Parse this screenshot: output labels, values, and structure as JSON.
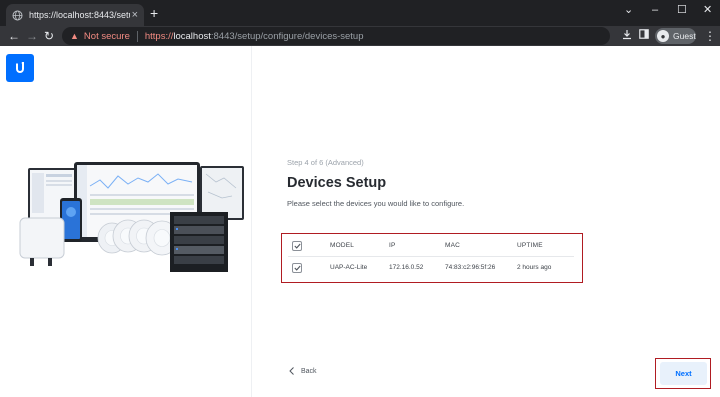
{
  "browser": {
    "tab_title": "https://localhost:8443/setup/configure/devices-setup",
    "tab_close": "×",
    "new_tab": "+",
    "window_controls": {
      "minimize": "–",
      "maximize": "☐",
      "close": "✕",
      "dropdown": "⌄"
    },
    "nav": {
      "back": "←",
      "forward": "→",
      "reload": "↻"
    },
    "address": {
      "warning_icon": "▲",
      "security_label": "Not secure",
      "url_scheme": "https://",
      "url_host": "localhost",
      "url_path": ":8443/setup/configure/devices-setup"
    },
    "profile_label": "Guest",
    "menu": "⋮"
  },
  "setup": {
    "step_label": "Step 4 of 6 (Advanced)",
    "title": "Devices Setup",
    "subtitle": "Please select the devices you would like to configure.",
    "table": {
      "columns": [
        "MODEL",
        "IP",
        "MAC",
        "UPTIME"
      ],
      "header_checked": true,
      "rows": [
        {
          "checked": true,
          "model": "UAP-AC-Lite",
          "ip": "172.16.0.52",
          "mac": "74:83:c2:96:5f:26",
          "uptime": "2 hours ago"
        }
      ]
    },
    "back_label": "Back",
    "next_label": "Next"
  },
  "colors": {
    "brand": "#006fff",
    "highlight": "#b01c22",
    "chrome_dark": "#202124",
    "chrome_toolbar": "#35363a"
  }
}
